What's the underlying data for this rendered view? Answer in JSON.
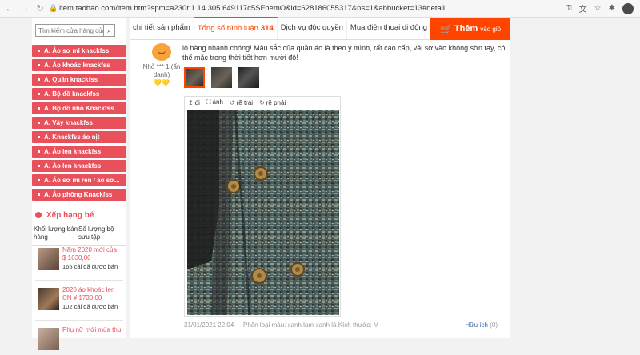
{
  "browser": {
    "back_icon": "arrow-left-icon",
    "forward_icon": "arrow-right-icon",
    "reload_icon": "reload-icon",
    "lock_icon": "lock-icon",
    "url": "item.taobao.com/item.htm?spm=a230r.1.14.305.649117c5SFhemO&id=628186055317&ns=1&abbucket=13#detail"
  },
  "search": {
    "placeholder": "Tìm kiếm cửa hàng của",
    "button_icon": "search-icon"
  },
  "categories": [
    "A. Áo sơ mi knackfss",
    "A. Áo khoác knackfss",
    "A. Quần knackfss",
    "A. Bộ đồ knackfss",
    "A. Bộ đồ nhỏ Knackfss",
    "A. Váy knackfss",
    "A. Knackfss áo nịt",
    "A. Áo len knackfss",
    "A. Áo len knackfss",
    "A. Áo sơ mi ren / áo sơ...",
    "A. Áo phông Knackfss"
  ],
  "ranking": {
    "title": "Xếp hạng bé",
    "tab_sales": "Khối lượng bán hàng",
    "tab_collection": "Số lượng bộ sưu tập",
    "items": [
      {
        "name": "Năm 2020 mới của",
        "price": "$ 1630,00",
        "sold": "165 cái đã được bán"
      },
      {
        "name": "2020 áo khoác len",
        "price": "CN ¥ 1730,00",
        "sold": "102 cái đã được bán"
      },
      {
        "name": "Phụ nữ mới mùa thu",
        "price": "",
        "sold": ""
      }
    ]
  },
  "tabs": {
    "details": "chi tiết sản phẩm",
    "reviews": "Tổng số bình luận",
    "reviews_count": "314",
    "exclusive": "Dịch vụ độc quyền",
    "mobile": "Mua điện thoại di động"
  },
  "cart": {
    "label": "Thêm",
    "sub": "vào giỏ",
    "icon": "cart-icon"
  },
  "review": {
    "reviewer_name": "Nhỏ *** 1 (ẩn danh)",
    "badge": "💛💛",
    "text": "lô hàng nhanh chóng! Màu sắc của quần áo là theo ý mình, rất cao cấp, vải sờ vào không sờn tay, có thể mặc trong thời tiết hơn mười độ!",
    "tool_rotate_up": "đi",
    "tool_image": "ảnh",
    "tool_rotate_left": "rẽ trái",
    "tool_rotate_right": "rẽ phải",
    "date": "31/01/2021 22:04",
    "sku": "Phân loại màu: xanh lam-xanh lá Kích thước: M",
    "useful": "Hữu ích",
    "useful_count": "(0)"
  }
}
